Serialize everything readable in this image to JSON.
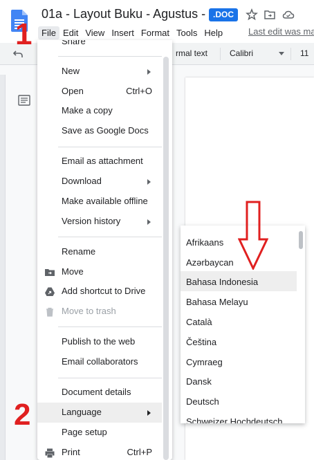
{
  "header": {
    "title": "01a - Layout Buku - Agustus - IE",
    "badge": ".DOC",
    "icons": [
      "star-icon",
      "move-to-folder-icon",
      "cloud-status-icon"
    ],
    "menus": [
      "File",
      "Edit",
      "View",
      "Insert",
      "Format",
      "Tools",
      "Help"
    ],
    "last_edit": "Last edit was ma"
  },
  "toolbar": {
    "style": "rmal text",
    "font": "Calibri",
    "size": "11"
  },
  "file_menu": {
    "share_partial": "Share",
    "items": [
      {
        "label": "New",
        "submenu": true
      },
      {
        "label": "Open",
        "shortcut": "Ctrl+O"
      },
      {
        "label": "Make a copy"
      },
      {
        "label": "Save as Google Docs"
      },
      {
        "label": "Email as attachment"
      },
      {
        "label": "Download",
        "submenu": true
      },
      {
        "label": "Make available offline"
      },
      {
        "label": "Version history",
        "submenu": true
      },
      {
        "label": "Rename"
      },
      {
        "label": "Move",
        "icon": "folder-move-icon"
      },
      {
        "label": "Add shortcut to Drive",
        "icon": "drive-shortcut-icon"
      },
      {
        "label": "Move to trash",
        "icon": "trash-icon",
        "disabled": true
      },
      {
        "label": "Publish to the web"
      },
      {
        "label": "Email collaborators"
      },
      {
        "label": "Document details"
      },
      {
        "label": "Language",
        "submenu": true,
        "highlighted": true
      },
      {
        "label": "Page setup"
      },
      {
        "label": "Print",
        "icon": "print-icon",
        "shortcut": "Ctrl+P"
      }
    ]
  },
  "language_menu": {
    "items": [
      {
        "label": "Afrikaans"
      },
      {
        "label": "Azərbaycan"
      },
      {
        "label": "Bahasa Indonesia",
        "highlighted": true
      },
      {
        "label": "Bahasa Melayu"
      },
      {
        "label": "Català"
      },
      {
        "label": "Čeština"
      },
      {
        "label": "Cymraeg"
      },
      {
        "label": "Dansk"
      },
      {
        "label": "Deutsch"
      },
      {
        "label": "Schweizer Hochdeutsch"
      }
    ]
  },
  "annotations": {
    "step1": "1",
    "step2": "2",
    "color": "#e02020"
  },
  "colors": {
    "accent": "#1a73e8",
    "docs_blue": "#4285f4"
  }
}
